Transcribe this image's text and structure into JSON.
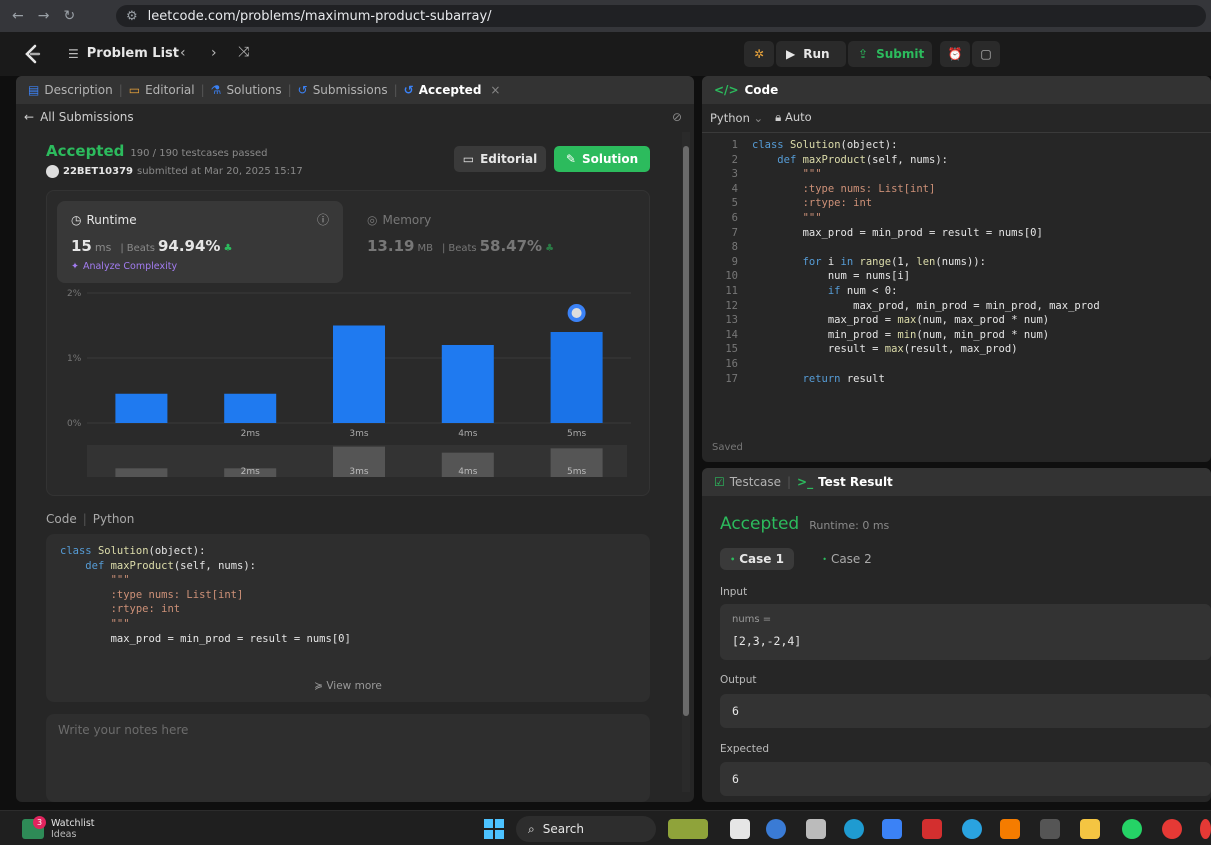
{
  "browser": {
    "url": "leetcode.com/problems/maximum-product-subarray/"
  },
  "header": {
    "problem_list": "Problem List",
    "run": "Run",
    "submit": "Submit"
  },
  "left_tabs": [
    {
      "label": "Description"
    },
    {
      "label": "Editorial"
    },
    {
      "label": "Solutions"
    },
    {
      "label": "Submissions"
    },
    {
      "label": "Accepted"
    }
  ],
  "submission": {
    "back_label": "All Submissions",
    "status": "Accepted",
    "testcases": "190 / 190 testcases passed",
    "user": "22BET10379",
    "submitted": "submitted at Mar 20, 2025 15:17",
    "editorial_btn": "Editorial",
    "solution_btn": "Solution"
  },
  "runtime": {
    "title": "Runtime",
    "value": "15",
    "unit": "ms",
    "beats_label": "Beats",
    "beats": "94.94%",
    "analyze": "Analyze Complexity"
  },
  "memory": {
    "title": "Memory",
    "value": "13.19",
    "unit": "MB",
    "beats_label": "Beats",
    "beats": "58.47%"
  },
  "chart_data": {
    "type": "bar",
    "y_ticks": [
      "2%",
      "1%",
      "0%"
    ],
    "ylim": [
      0,
      2
    ],
    "categories": [
      "",
      "2ms",
      "3ms",
      "4ms",
      "5ms"
    ],
    "values": [
      0.45,
      0.45,
      1.5,
      1.2,
      1.4
    ],
    "mini_labels": [
      "",
      "2ms",
      "3ms",
      "4ms",
      "5ms"
    ],
    "mini_values": [
      0.1,
      0.1,
      0.35,
      0.28,
      0.33
    ]
  },
  "code_preview": {
    "header": "Code",
    "lang": "Python",
    "lines": [
      "class Solution(object):",
      "    def maxProduct(self, nums):",
      "        \"\"\"",
      "        :type nums: List[int]",
      "        :rtype: int",
      "        \"\"\"",
      "        max_prod = min_prod = result = nums[0]"
    ],
    "view_more": "View more"
  },
  "notes_placeholder": "Write your notes here",
  "editor": {
    "title": "Code",
    "lang": "Python",
    "mode": "Auto",
    "saved": "Saved",
    "line_numbers": [
      "1",
      "2",
      "3",
      "4",
      "5",
      "6",
      "7",
      "8",
      "9",
      "10",
      "11",
      "12",
      "13",
      "14",
      "15",
      "16",
      "17"
    ],
    "lines": [
      "class Solution(object):",
      "    def maxProduct(self, nums):",
      "        \"\"\"",
      "        :type nums: List[int]",
      "        :rtype: int",
      "        \"\"\"",
      "        max_prod = min_prod = result = nums[0]",
      "",
      "        for i in range(1, len(nums)):",
      "            num = nums[i]",
      "            if num < 0:",
      "                max_prod, min_prod = min_prod, max_prod",
      "            max_prod = max(num, max_prod * num)",
      "            min_prod = min(num, min_prod * num)",
      "            result = max(result, max_prod)",
      "",
      "        return result"
    ]
  },
  "test": {
    "tab1": "Testcase",
    "tab2": "Test Result",
    "status": "Accepted",
    "runtime": "Runtime: 0 ms",
    "case1": "Case 1",
    "case2": "Case 2",
    "input_label": "Input",
    "input_var": "nums =",
    "input_value": "[2,3,-2,4]",
    "output_label": "Output",
    "output_value": "6",
    "expected_label": "Expected",
    "expected_value": "6"
  },
  "taskbar": {
    "watch_title": "Watchlist",
    "watch_sub": "Ideas",
    "badge": "3",
    "search": "Search"
  },
  "colors": {
    "accent_green": "#2cbb5d",
    "bar_blue": "#1a73e8",
    "bg": "#1a1a1a"
  }
}
